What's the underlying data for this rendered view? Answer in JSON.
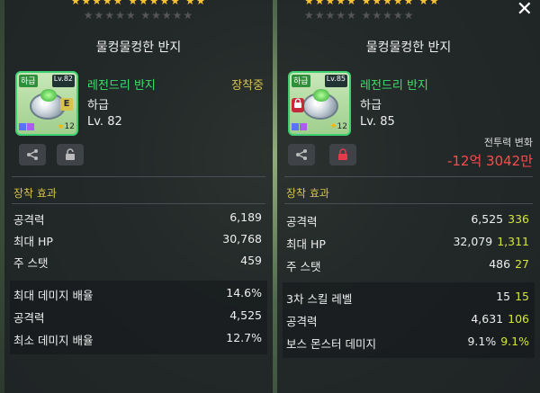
{
  "left_panel": {
    "stars_top": "★★★★★ ★★★★★ ★★",
    "stars_mid": "★★★★★ ★★★★★",
    "title": "물컹물컹한 반지",
    "item_grade_tag": "하급",
    "item_level_tag": "Lv.82",
    "item_badge": "E",
    "item_star_count": "12",
    "item_name": "레전드리 반지",
    "equipped_label": "장착중",
    "grade_text": "하급",
    "level_text": "Lv. 82",
    "section_title": "장착 효과",
    "stats": [
      {
        "label": "공격력",
        "value": "6,189"
      },
      {
        "label": "최대 HP",
        "value": "30,768"
      },
      {
        "label": "주 스탯",
        "value": "459"
      }
    ],
    "extra_stats": [
      {
        "label": "최대 데미지 배율",
        "value": "14.6%"
      },
      {
        "label": "공격력",
        "value": "4,525"
      },
      {
        "label": "최소 데미지 배율",
        "value": "12.7%"
      }
    ]
  },
  "right_panel": {
    "stars_top": "★★★★★ ★★★★★ ★★",
    "stars_mid": "★★★★★ ★★★★★",
    "close_label": "✕",
    "title": "물컹물컹한 반지",
    "item_grade_tag": "하급",
    "item_level_tag": "Lv.85",
    "item_star_count": "12",
    "item_name": "레전드리 반지",
    "grade_text": "하급",
    "level_text": "Lv. 85",
    "cp_label": "전투력 변화",
    "cp_value": "-12억 3042만",
    "section_title": "장착 효과",
    "stats": [
      {
        "label": "공격력",
        "value": "6,525",
        "bonus": "336"
      },
      {
        "label": "최대 HP",
        "value": "32,079",
        "bonus": "1,311"
      },
      {
        "label": "주 스탯",
        "value": "486",
        "bonus": "27"
      }
    ],
    "extra_stats": [
      {
        "label": "3차 스킬 레벨",
        "value": "15",
        "bonus": "15"
      },
      {
        "label": "공격력",
        "value": "4,631",
        "bonus": "106"
      },
      {
        "label": "보스 몬스터 데미지",
        "value": "9.1%",
        "bonus": "9.1%"
      }
    ]
  },
  "colors": {
    "item_name": "#3ee06a",
    "equipped": "#d6c34b",
    "section_title": "#d6c34b",
    "bonus": "#d4e63a",
    "cp_negative": "#ff4b4b",
    "frame_green": "#3ed070"
  }
}
